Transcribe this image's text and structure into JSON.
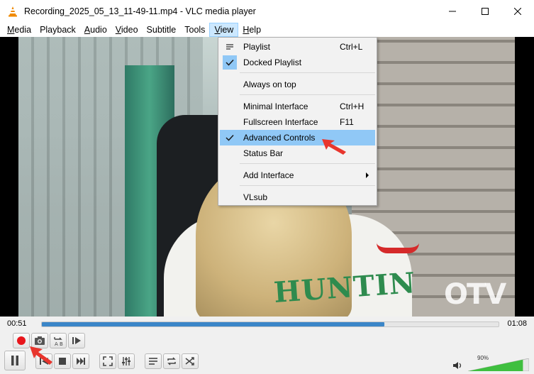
{
  "window": {
    "title": "Recording_2025_05_13_11-49-11.mp4 - VLC media player"
  },
  "menubar": {
    "items": [
      {
        "label": "Media",
        "u": "M",
        "rest": "edia"
      },
      {
        "label": "Playback",
        "u": "",
        "rest": "Playback"
      },
      {
        "label": "Audio",
        "u": "A",
        "rest": "udio"
      },
      {
        "label": "Video",
        "u": "V",
        "rest": "ideo"
      },
      {
        "label": "Subtitle",
        "u": "",
        "rest": "Subtitle"
      },
      {
        "label": "Tools",
        "u": "",
        "rest": "Tools"
      },
      {
        "label": "View",
        "u": "V",
        "rest": "iew"
      },
      {
        "label": "Help",
        "u": "H",
        "rest": "elp"
      }
    ]
  },
  "view_menu": {
    "items": [
      {
        "label": "Playlist",
        "shortcut": "Ctrl+L",
        "checked": false
      },
      {
        "label": "Docked Playlist",
        "shortcut": "",
        "checked": true
      },
      {
        "label": "Always on top",
        "shortcut": "",
        "checked": false
      },
      {
        "label": "Minimal Interface",
        "shortcut": "Ctrl+H",
        "checked": false
      },
      {
        "label": "Fullscreen Interface",
        "shortcut": "F11",
        "checked": false
      },
      {
        "label": "Advanced Controls",
        "shortcut": "",
        "checked": true,
        "highlighted": true
      },
      {
        "label": "Status Bar",
        "shortcut": "",
        "checked": false
      },
      {
        "label": "Add Interface",
        "shortcut": "",
        "submenu": true
      },
      {
        "label": "VLsub",
        "shortcut": ""
      }
    ]
  },
  "video": {
    "overlay_text": "HUNTIN",
    "watermark": "OTV"
  },
  "playback": {
    "current_time": "00:51",
    "total_time": "01:08",
    "progress_fraction": 0.75
  },
  "volume": {
    "percent_label": "90%",
    "level_fraction": 0.9
  },
  "colors": {
    "accent_blue": "#3b86c8",
    "menu_highlight": "#90c8f6",
    "record_red": "#e8151b",
    "annotation_red": "#e8352d",
    "volume_green": "#3fbf3f"
  }
}
